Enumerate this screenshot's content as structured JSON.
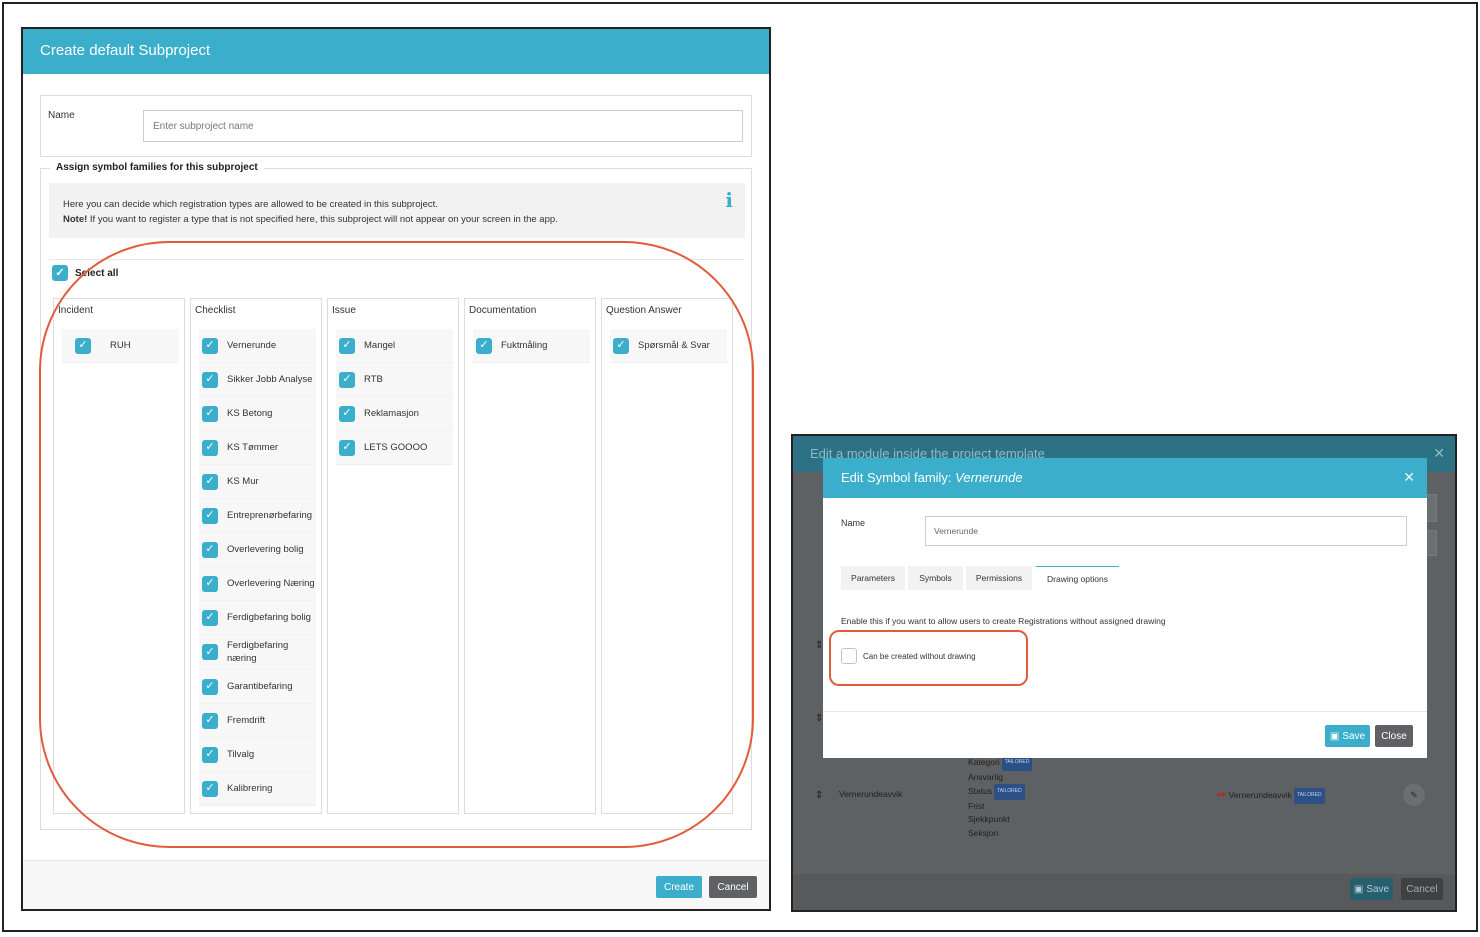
{
  "create_dialog": {
    "title": "Create default Subproject",
    "name_label": "Name",
    "name_placeholder": "Enter subproject name",
    "assign_legend": "Assign symbol families for this subproject",
    "info_line1": "Here you can decide which registration types are allowed to be created in this subproject.",
    "info_note_bold": "Note!",
    "info_line2": " If you want to register a type that is not specified here, this subproject will not appear on your screen in the app.",
    "select_all_label": "Select all",
    "columns": [
      {
        "title": "Incident",
        "items": [
          "RUH"
        ]
      },
      {
        "title": "Checklist",
        "items": [
          "Vernerunde",
          "Sikker Jobb Analyse",
          "KS Betong",
          "KS Tømmer",
          "KS Mur",
          "Entreprenørbefaring",
          "Overlevering bolig",
          "Overlevering Næring",
          "Ferdigbefaring bolig",
          "Ferdigbefaring næring",
          "Garantibefaring",
          "Fremdrift",
          "Tilvalg",
          "Kalibrering"
        ]
      },
      {
        "title": "Issue",
        "items": [
          "Mangel",
          "RTB",
          "Reklamasjon",
          "LETS GOOOO"
        ]
      },
      {
        "title": "Documentation",
        "items": [
          "Fuktmåling"
        ]
      },
      {
        "title": "Question Answer",
        "items": [
          "Spørsmål & Svar"
        ]
      }
    ],
    "create_label": "Create",
    "cancel_label": "Cancel"
  },
  "background_dialog": {
    "title": "Edit a module inside the project template",
    "row_name": "Vernerundeavvik",
    "fields": [
      "Kategori",
      "Ansvarlig",
      "Status",
      "Frist",
      "Sjekkpunkt",
      "Seksjon"
    ],
    "tag_label": "TAILORED",
    "linked_name": "Vernerundeavvik",
    "save_label": "Save",
    "cancel_label": "Cancel"
  },
  "edit_modal": {
    "title_prefix": "Edit Symbol family: ",
    "title_name": "Vernerunde",
    "name_label": "Name",
    "name_value": "Vernerunde",
    "tabs": [
      "Parameters",
      "Symbols",
      "Permissions",
      "Drawing options"
    ],
    "description": "Enable this if you want to allow users to create Registrations without assigned drawing",
    "option_label": "Can be created without drawing",
    "save_label": "Save",
    "close_label": "Close"
  },
  "colors": {
    "accent": "#3aaecb",
    "annotation": "#e25b3b",
    "secondary_button": "#5f6164"
  }
}
